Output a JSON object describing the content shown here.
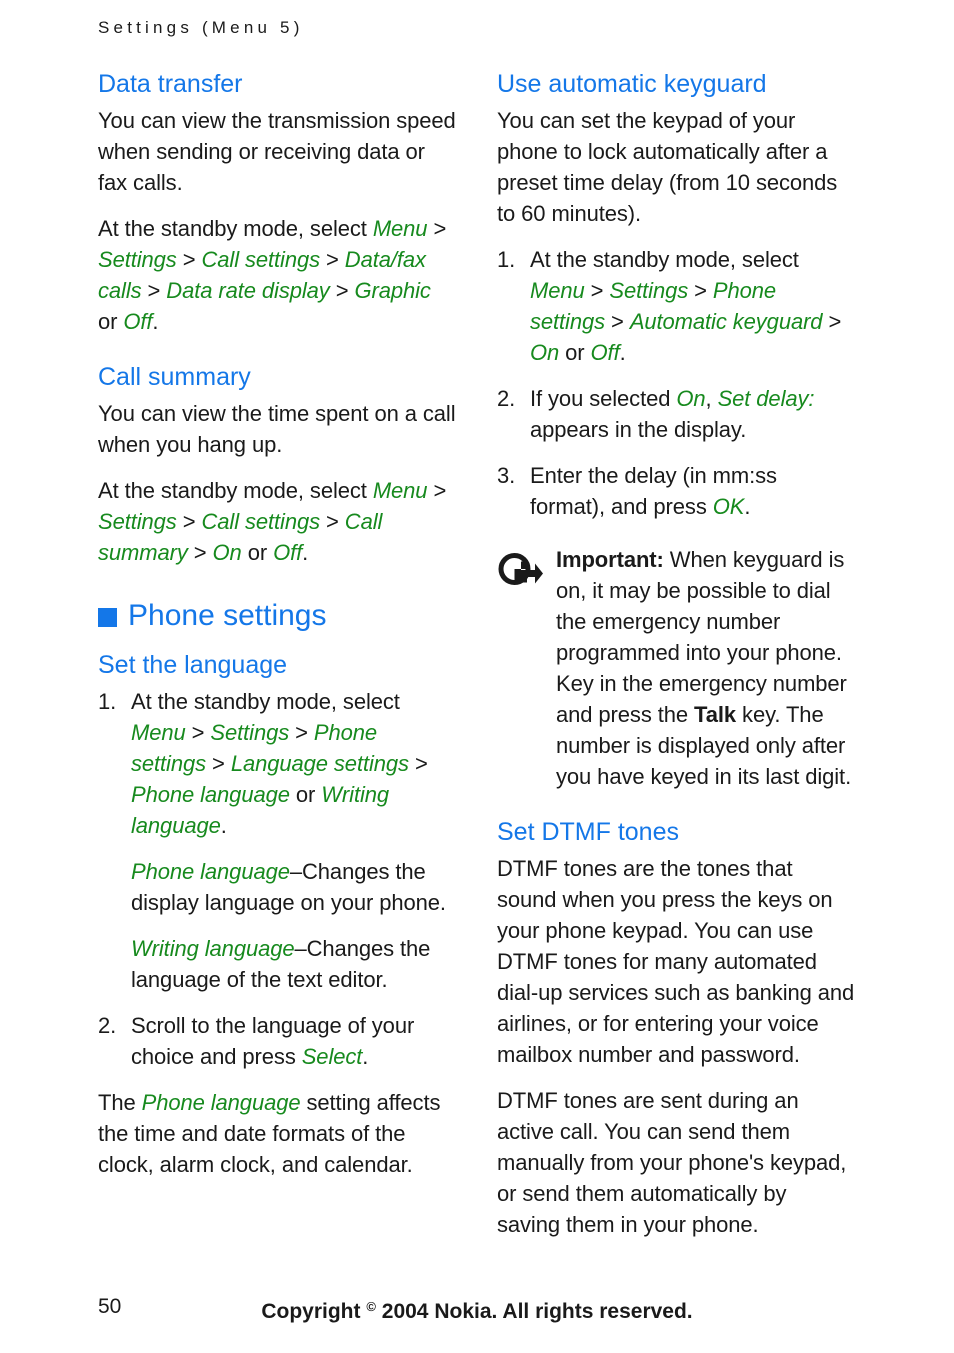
{
  "page": {
    "running_header": "Settings (Menu 5)",
    "folio": "50",
    "copyright_prefix": "Copyright ",
    "copyright_symbol": "©",
    "copyright_suffix": " 2004 Nokia. All rights reserved."
  },
  "colors": {
    "heading_blue": "#1477e8",
    "menu_green": "#178a1e",
    "body_black": "#1a1a1a"
  },
  "left_column": {
    "data_transfer": {
      "heading": "Data transfer",
      "p1": "You can view the transmission speed when sending or receiving data or fax calls.",
      "p2_lead": "At the standby mode, select ",
      "p2_menu": "Menu",
      "p2_sep1": " > ",
      "p2_settings": "Settings",
      "p2_sep2": " > ",
      "p2_callsettings": "Call settings",
      "p2_sep3": " > ",
      "p2_datafax": "Data/fax calls",
      "p2_sep4": " > ",
      "p2_datarate": "Data rate display",
      "p2_sep5": " > ",
      "p2_graphic": "Graphic",
      "p2_or": " or ",
      "p2_off": "Off",
      "p2_end": "."
    },
    "call_summary": {
      "heading": "Call summary",
      "p1": "You can view the time spent on a call when you hang up.",
      "p2_lead": "At the standby mode, select ",
      "p2_menu": "Menu",
      "p2_sep1": " > ",
      "p2_settings": "Settings",
      "p2_sep2": " > ",
      "p2_callsettings": "Call settings",
      "p2_sep3": " > ",
      "p2_callsummary": "Call summary",
      "p2_sep4": " > ",
      "p2_on": "On",
      "p2_or": " or ",
      "p2_off": "Off",
      "p2_end": "."
    },
    "phone_settings_chapter": "Phone settings",
    "set_language": {
      "heading": "Set the language",
      "step1_lead": "At the standby mode, select ",
      "step1_menu": "Menu",
      "step1_sep1": " > ",
      "step1_settings": "Settings",
      "step1_sep2": " > ",
      "step1_phonesettings": "Phone settings",
      "step1_sep3": " > ",
      "step1_langsettings": "Language settings",
      "step1_sep4": " > ",
      "step1_phonelang": "Phone language",
      "step1_or": " or ",
      "step1_writinglang": "Writing language",
      "step1_end": ".",
      "sub1_term": "Phone language",
      "sub1_text": "–Changes the display language on your phone.",
      "sub2_term": "Writing language",
      "sub2_text": "–Changes the language of the text editor.",
      "step2_lead": "Scroll to the language of your choice and press ",
      "step2_select": "Select",
      "step2_end": ".",
      "closing_lead": "The ",
      "closing_term": "Phone language",
      "closing_text": " setting affects the time and date formats of the clock, alarm clock, and calendar."
    }
  },
  "right_column": {
    "auto_keyguard": {
      "heading": "Use automatic keyguard",
      "p1": "You can set the keypad of your phone to lock automatically after a preset time delay (from 10 seconds to 60 minutes).",
      "step1_lead": "At the standby mode, select ",
      "step1_menu": "Menu",
      "step1_sep1": " > ",
      "step1_settings": "Settings",
      "step1_sep2": " > ",
      "step1_phonesettings": "Phone settings",
      "step1_sep3": " > ",
      "step1_autokeyguard": "Automatic keyguard",
      "step1_sep4": " > ",
      "step1_on": "On",
      "step1_or": " or ",
      "step1_off": "Off",
      "step1_end": ".",
      "step2_lead": "If you selected ",
      "step2_on": "On",
      "step2_comma": ", ",
      "step2_setdelay": "Set delay:",
      "step2_tail": " appears in the display.",
      "step3_lead": "Enter the delay (in mm:ss format), and press ",
      "step3_ok": "OK",
      "step3_end": "."
    },
    "note": {
      "icon": "important-arrow-icon",
      "label": "Important:",
      "text_part1": " When keyguard is on, it may be possible to dial the emergency number programmed into your phone. Key in the emergency number and press the ",
      "bold_key": "Talk",
      "text_part2": " key. The number is displayed only after you have keyed in its last digit."
    },
    "dtmf": {
      "heading": "Set DTMF tones",
      "p1": "DTMF tones are the tones that sound when you press the keys on your phone keypad. You can use DTMF tones for many automated dial-up services such as banking and airlines, or for entering your voice mailbox number and password.",
      "p2": "DTMF tones are sent during an active call. You can send them manually from your phone's keypad, or send them automatically by saving them in your phone."
    }
  }
}
